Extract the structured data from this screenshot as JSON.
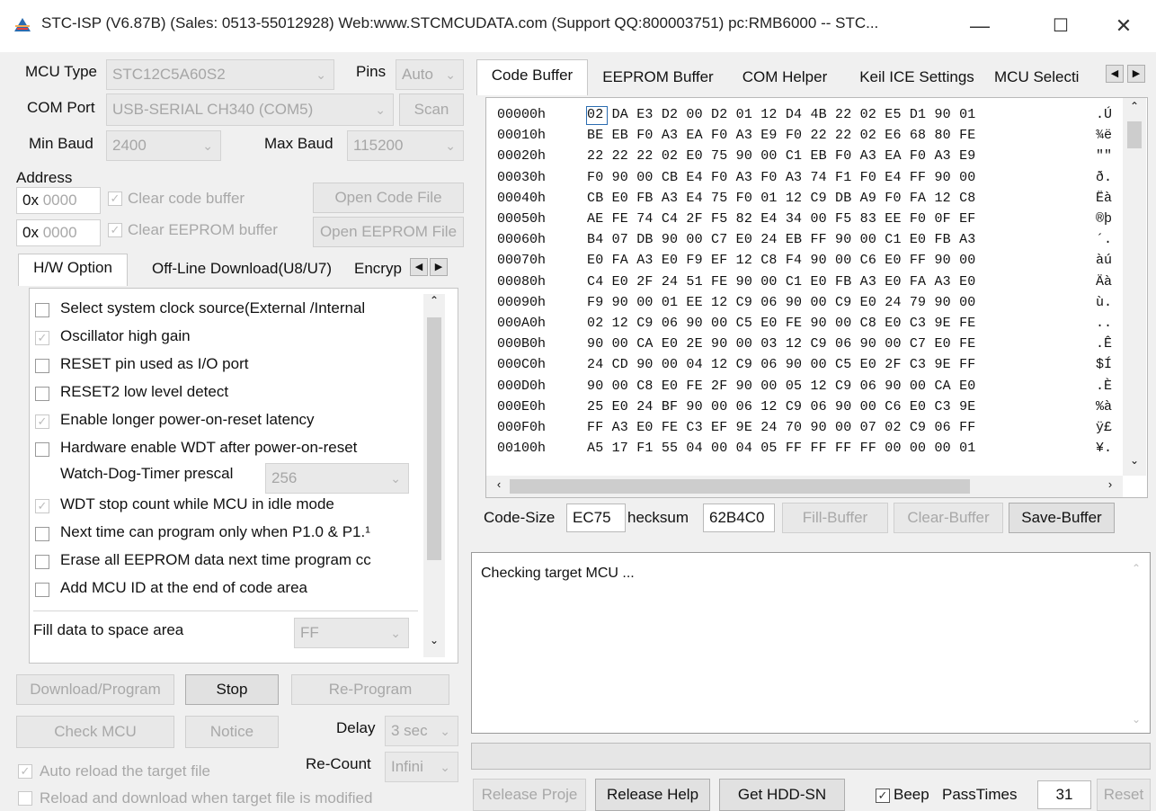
{
  "window": {
    "title": "STC-ISP (V6.87B) (Sales: 0513-55012928) Web:www.STCMCUDATA.com  (Support QQ:800003751) pc:RMB6000 -- STC...",
    "minimize": "—",
    "maximize": "☐",
    "close": "✕"
  },
  "left": {
    "mcu_type_label": "MCU Type",
    "mcu_type_value": "STC12C5A60S2",
    "pins_label": "Pins",
    "pins_value": "Auto",
    "com_port_label": "COM Port",
    "com_port_value": "USB-SERIAL CH340 (COM5)",
    "scan_label": "Scan",
    "min_baud_label": "Min Baud",
    "min_baud_value": "2400",
    "max_baud_label": "Max Baud",
    "max_baud_value": "115200",
    "address_label": "Address",
    "addr1_prefix": "0x",
    "addr1_value": "0000",
    "addr2_prefix": "0x",
    "addr2_value": "0000",
    "clear_code_label": "Clear code buffer",
    "clear_eeprom_label": "Clear EEPROM buffer",
    "open_code_label": "Open Code File",
    "open_eeprom_label": "Open EEPROM File",
    "tabs": [
      "H/W Option",
      "Off-Line Download(U8/U7)",
      "Encryp"
    ],
    "options": [
      {
        "label": "Select system clock source(External /Internal",
        "checked": false
      },
      {
        "label": "Oscillator high gain",
        "checked": true
      },
      {
        "label": "RESET pin used as I/O port",
        "checked": false
      },
      {
        "label": "RESET2 low level detect",
        "checked": false
      },
      {
        "label": "Enable longer power-on-reset latency",
        "checked": true
      },
      {
        "label": "Hardware enable WDT after power-on-reset",
        "checked": false
      }
    ],
    "wdt_prescale_label": "Watch-Dog-Timer prescal",
    "wdt_prescale_value": "256",
    "options2": [
      {
        "label": "WDT stop count while MCU in idle mode",
        "checked": true
      },
      {
        "label": "Next time can program only when P1.0 & P1.¹",
        "checked": false
      },
      {
        "label": "Erase all EEPROM data next time program cc",
        "checked": false
      },
      {
        "label": "Add MCU ID at the end of code area",
        "checked": false
      }
    ],
    "fill_label": "Fill data to space area",
    "fill_value": "FF",
    "download_label": "Download/Program",
    "stop_label": "Stop",
    "reprogram_label": "Re-Program",
    "check_mcu_label": "Check MCU",
    "notice_label": "Notice",
    "delay_label": "Delay",
    "delay_value": "3 sec",
    "recount_label": "Re-Count",
    "recount_value": "Infini",
    "auto_reload_label": "Auto reload the target file",
    "reload_modified_label": "Reload and download when target file is modified"
  },
  "right": {
    "tabs": [
      "Code Buffer",
      "EEPROM Buffer",
      "COM Helper",
      "Keil ICE Settings",
      "MCU Selecti"
    ],
    "hex_rows": [
      {
        "addr": "00000h",
        "bytes": "02 DA E3 D2 00 D2 01 12 D4 4B 22 02 E5 D1 90 01",
        "ascii": ".Ú"
      },
      {
        "addr": "00010h",
        "bytes": "BE EB F0 A3 EA F0 A3 E9 F0 22 22 02 E6 68 80 FE",
        "ascii": "¾ë"
      },
      {
        "addr": "00020h",
        "bytes": "22 22 22 02 E0 75 90 00 C1 EB F0 A3 EA F0 A3 E9",
        "ascii": "\"\""
      },
      {
        "addr": "00030h",
        "bytes": "F0 90 00 CB E4 F0 A3 F0 A3 74 F1 F0 E4 FF 90 00",
        "ascii": "ð."
      },
      {
        "addr": "00040h",
        "bytes": "CB E0 FB A3 E4 75 F0 01 12 C9 DB A9 F0 FA 12 C8",
        "ascii": "Ëà"
      },
      {
        "addr": "00050h",
        "bytes": "AE FE 74 C4 2F F5 82 E4 34 00 F5 83 EE F0 0F EF",
        "ascii": "®þ"
      },
      {
        "addr": "00060h",
        "bytes": "B4 07 DB 90 00 C7 E0 24 EB FF 90 00 C1 E0 FB A3",
        "ascii": "´."
      },
      {
        "addr": "00070h",
        "bytes": "E0 FA A3 E0 F9 EF 12 C8 F4 90 00 C6 E0 FF 90 00",
        "ascii": "àú"
      },
      {
        "addr": "00080h",
        "bytes": "C4 E0 2F 24 51 FE 90 00 C1 E0 FB A3 E0 FA A3 E0",
        "ascii": "Äà"
      },
      {
        "addr": "00090h",
        "bytes": "F9 90 00 01 EE 12 C9 06 90 00 C9 E0 24 79 90 00",
        "ascii": "ù."
      },
      {
        "addr": "000A0h",
        "bytes": "02 12 C9 06 90 00 C5 E0 FE 90 00 C8 E0 C3 9E FE",
        "ascii": ".."
      },
      {
        "addr": "000B0h",
        "bytes": "90 00 CA E0 2E 90 00 03 12 C9 06 90 00 C7 E0 FE",
        "ascii": ".Ê"
      },
      {
        "addr": "000C0h",
        "bytes": "24 CD 90 00 04 12 C9 06 90 00 C5 E0 2F C3 9E FF",
        "ascii": "$Í"
      },
      {
        "addr": "000D0h",
        "bytes": "90 00 C8 E0 FE 2F 90 00 05 12 C9 06 90 00 CA E0",
        "ascii": ".È"
      },
      {
        "addr": "000E0h",
        "bytes": "25 E0 24 BF 90 00 06 12 C9 06 90 00 C6 E0 C3 9E",
        "ascii": "%à"
      },
      {
        "addr": "000F0h",
        "bytes": "FF A3 E0 FE C3 EF 9E 24 70 90 00 07 02 C9 06 FF",
        "ascii": "ÿ£"
      },
      {
        "addr": "00100h",
        "bytes": "A5 17 F1 55 04 00 04 05 FF FF FF FF 00 00 00 01",
        "ascii": "¥."
      }
    ],
    "code_size_label": "Code-Size",
    "code_size_value": "EC75",
    "checksum_label": "hecksum",
    "checksum_value": "62B4C0",
    "fill_buffer_label": "Fill-Buffer",
    "clear_buffer_label": "Clear-Buffer",
    "save_buffer_label": "Save-Buffer",
    "log_text": "Checking target MCU ...",
    "release_project_label": "Release Proje",
    "release_help_label": "Release Help",
    "get_hdd_sn_label": "Get HDD-SN",
    "beep_label": "Beep",
    "beep_checked": true,
    "pass_times_label": "PassTimes",
    "pass_times_value": "31",
    "reset_label": "Reset"
  }
}
